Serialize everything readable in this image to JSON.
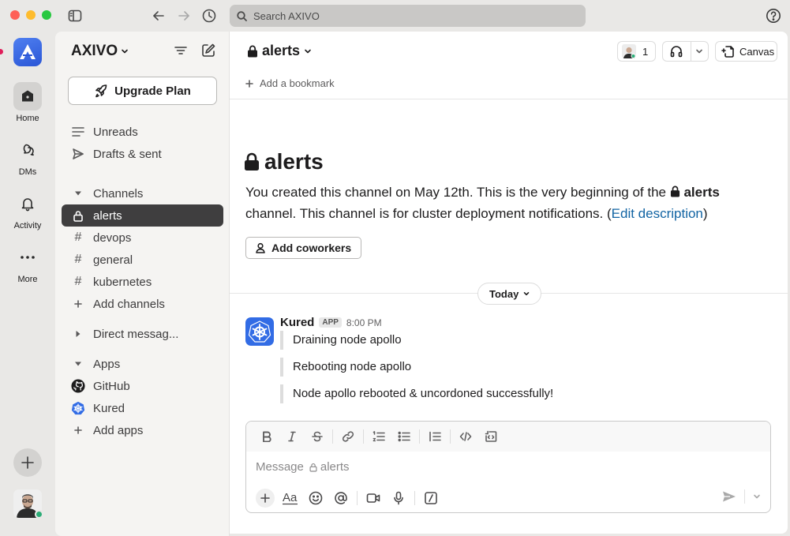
{
  "titlebar": {
    "search_placeholder": "Search AXIVO"
  },
  "rail": {
    "items": [
      {
        "label": "Home",
        "icon": "home-icon"
      },
      {
        "label": "DMs",
        "icon": "dms-icon"
      },
      {
        "label": "Activity",
        "icon": "bell-icon"
      },
      {
        "label": "More",
        "icon": "more-icon"
      }
    ]
  },
  "sidebar": {
    "workspace": "AXIVO",
    "upgrade_label": "Upgrade Plan",
    "unreads": "Unreads",
    "drafts": "Drafts & sent",
    "channels_header": "Channels",
    "channels": [
      "alerts",
      "devops",
      "general",
      "kubernetes"
    ],
    "add_channels": "Add channels",
    "direct_messages": "Direct messag...",
    "apps_header": "Apps",
    "apps": [
      "GitHub",
      "Kured"
    ],
    "add_apps": "Add apps"
  },
  "header": {
    "channel_name": "alerts",
    "member_count": "1",
    "canvas_label": "Canvas",
    "add_bookmark": "Add a bookmark"
  },
  "intro": {
    "title": "alerts",
    "text_1": "You created this channel on May 12th. This is the very beginning of the ",
    "channel": "alerts",
    "text_2": " channel. This channel is for cluster deployment notifications. (",
    "edit_link": "Edit description",
    "text_3": ")",
    "add_coworkers": "Add coworkers"
  },
  "divider": {
    "label": "Today"
  },
  "message": {
    "sender": "Kured",
    "badge": "APP",
    "time": "8:00 PM",
    "lines": [
      "Draining node apollo",
      "Rebooting node apollo",
      "Node apollo rebooted & uncordoned successfully!"
    ]
  },
  "composer": {
    "placeholder_prefix": "Message",
    "placeholder_channel": "alerts"
  },
  "colors": {
    "accent_link": "#1264a3",
    "active_channel_bg": "#3f3e3f",
    "presence": "#2bac76",
    "kubernetes_blue": "#326ce5"
  }
}
